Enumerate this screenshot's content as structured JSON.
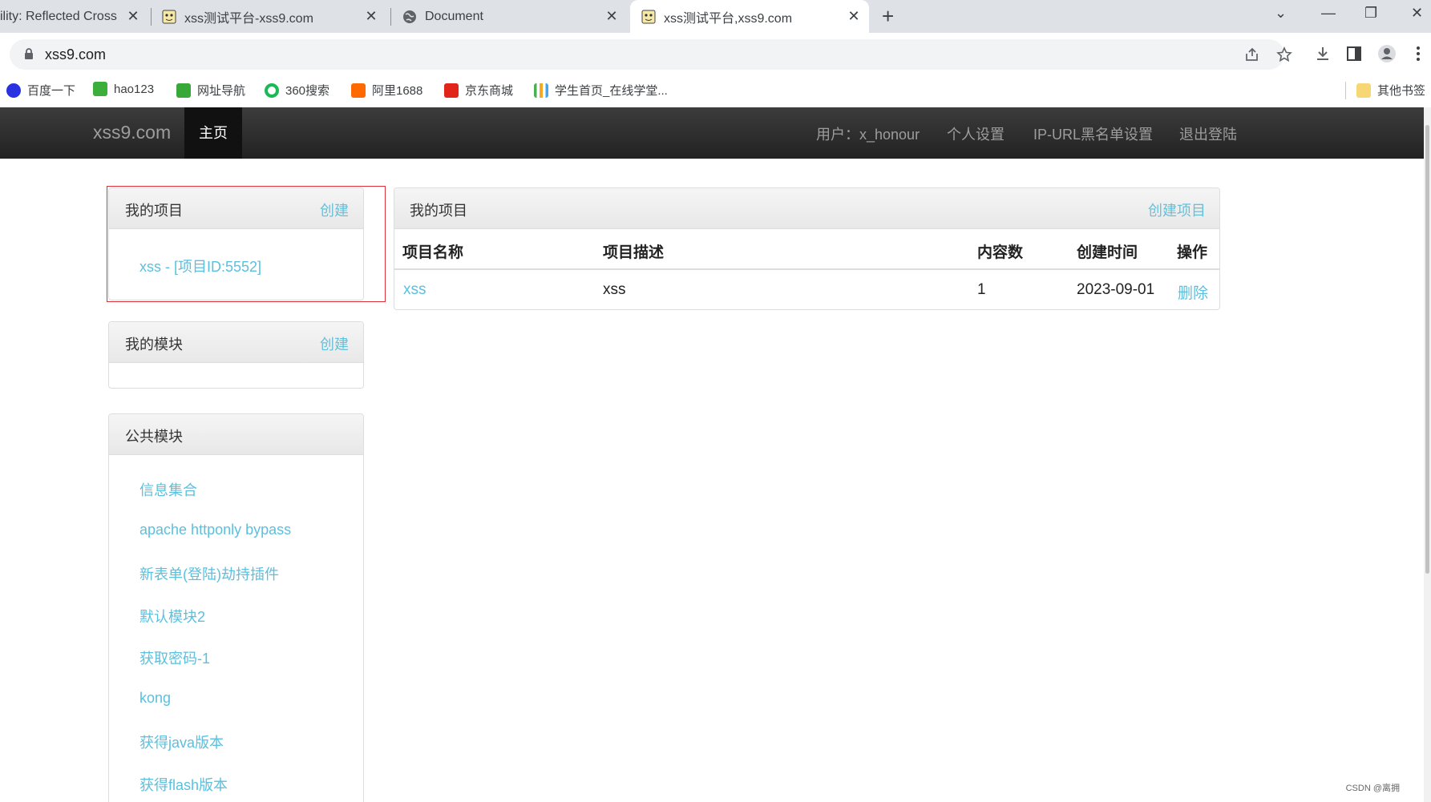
{
  "browser": {
    "tabs": [
      {
        "title": "ility: Reflected Cross S",
        "active": false
      },
      {
        "title": "xss测试平台-xss9.com",
        "active": false
      },
      {
        "title": "Document",
        "active": false
      },
      {
        "title": "xss测试平台,xss9.com",
        "active": true
      }
    ],
    "close_glyph": "✕",
    "new_tab_glyph": "+",
    "url": "xss9.com",
    "bookmarks": [
      {
        "label": "百度一下",
        "color": "#2932e1"
      },
      {
        "label": "hao123",
        "color": "#3cae3c"
      },
      {
        "label": "网址导航",
        "color": "#38a838"
      },
      {
        "label": "360搜索",
        "color": "#19b955"
      },
      {
        "label": "阿里1688",
        "color": "#ff6a00"
      },
      {
        "label": "京东商城",
        "color": "#e1251b"
      },
      {
        "label": "学生首页_在线学堂...",
        "color": "#4caf50"
      }
    ],
    "other_bookmarks": "其他书签"
  },
  "navbar": {
    "brand": "xss9.com",
    "home": "主页",
    "user": "用户：x_honour",
    "settings": "个人设置",
    "blacklist": "IP-URL黑名单设置",
    "logout": "退出登陆"
  },
  "my_projects_panel": {
    "title": "我的项目",
    "action": "创建",
    "items": [
      "xss - [项目ID:5552]"
    ]
  },
  "my_modules_panel": {
    "title": "我的模块",
    "action": "创建"
  },
  "public_modules_panel": {
    "title": "公共模块",
    "items": [
      "信息集合",
      "apache httponly bypass",
      "新表单(登陆)劫持插件",
      "默认模块2",
      "获取密码-1",
      "kong",
      "获得java版本",
      "获得flash版本"
    ]
  },
  "projects_table_panel": {
    "title": "我的项目",
    "action": "创建项目",
    "headers": [
      "项目名称",
      "项目描述",
      "内容数",
      "创建时间",
      "操作"
    ],
    "rows": [
      {
        "name": "xss",
        "description": "xss",
        "count": "1",
        "created": "2023-09-01",
        "action": "删除"
      }
    ]
  },
  "watermark": "CSDN @离拥",
  "colors": {
    "link": "#5bc0de",
    "navbar": "#222222",
    "highlight": "#e0303a"
  }
}
